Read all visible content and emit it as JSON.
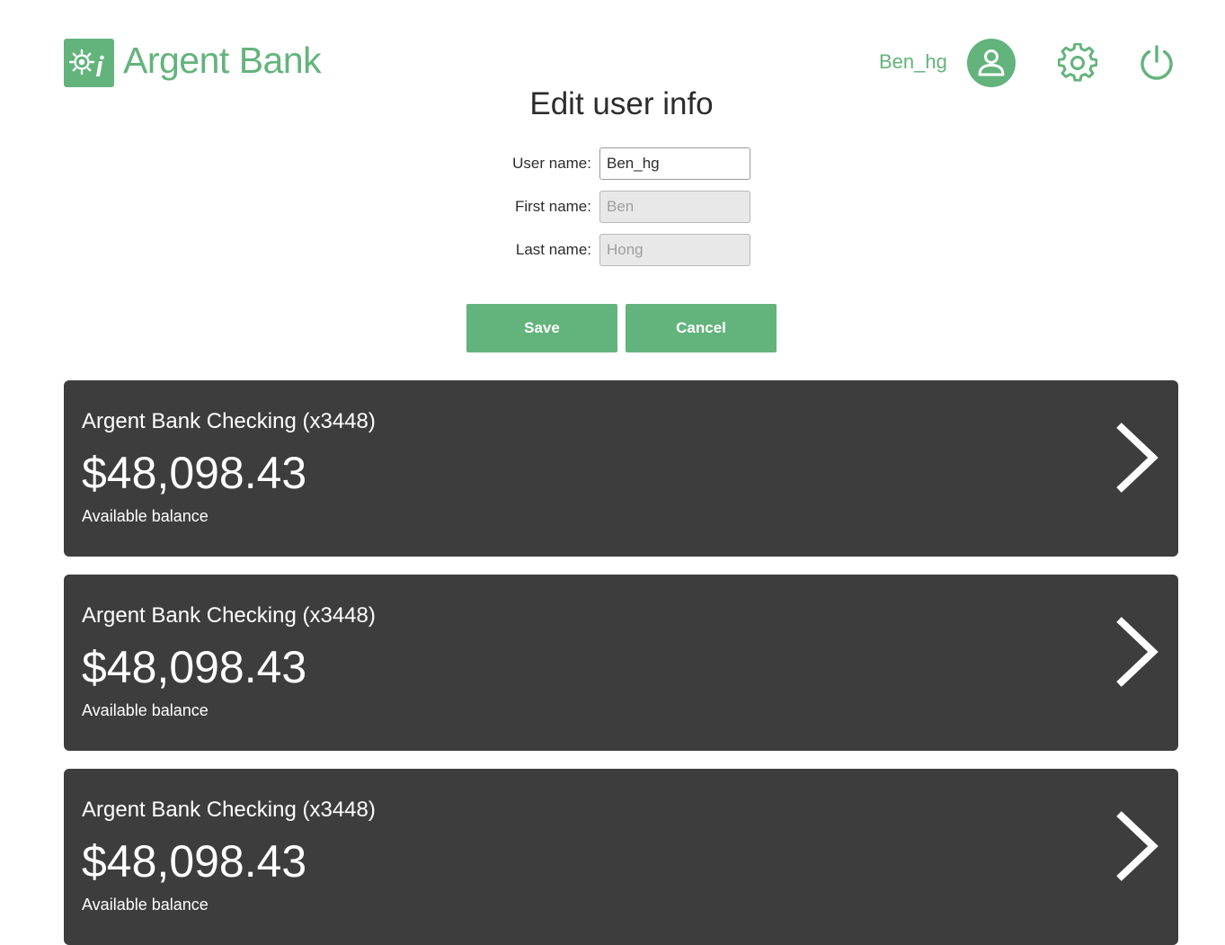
{
  "brand": {
    "name": "Argent Bank",
    "color": "#63b37c"
  },
  "header": {
    "username": "Ben_hg",
    "icons": [
      "user-icon",
      "gear-icon",
      "power-icon"
    ]
  },
  "edit_form": {
    "title": "Edit user info",
    "fields": [
      {
        "label": "User name:",
        "value": "Ben_hg",
        "editable": true
      },
      {
        "label": "First name:",
        "value": "Ben",
        "editable": false
      },
      {
        "label": "Last name:",
        "value": "Hong",
        "editable": false
      }
    ],
    "save_label": "Save",
    "cancel_label": "Cancel"
  },
  "accounts": [
    {
      "title": "Argent Bank Checking (x3448)",
      "amount": "$48,098.43",
      "description": "Available balance"
    },
    {
      "title": "Argent Bank Checking (x3448)",
      "amount": "$48,098.43",
      "description": "Available balance"
    },
    {
      "title": "Argent Bank Checking (x3448)",
      "amount": "$48,098.43",
      "description": "Available balance"
    }
  ]
}
